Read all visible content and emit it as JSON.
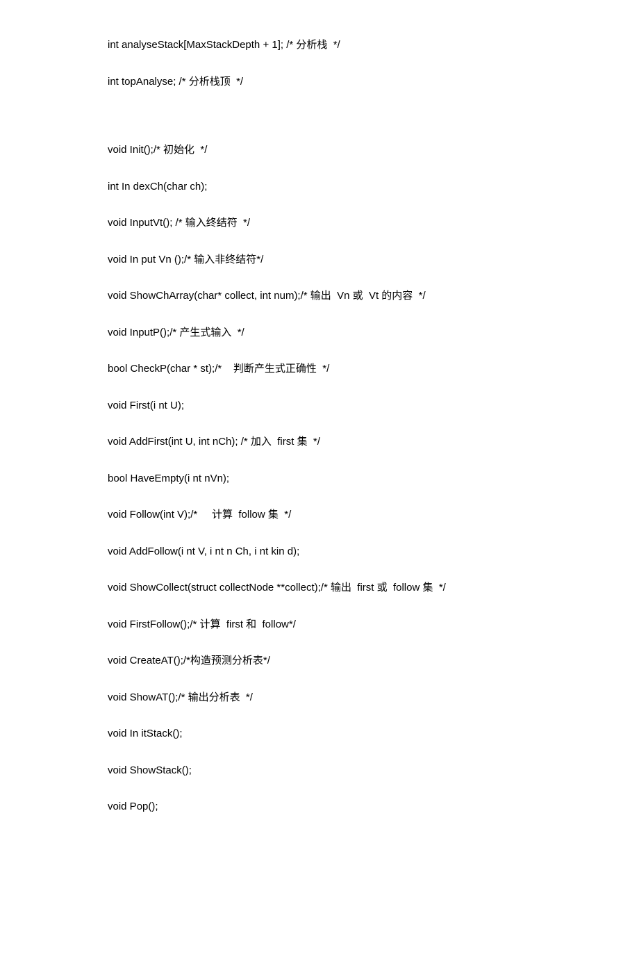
{
  "lines": [
    "int analyseStack[MaxStackDepth + 1]; /* 分析栈  */",
    "int topAnalyse; /* 分析栈顶  */",
    "GAP",
    "void Init();/* 初始化  */",
    "int In dexCh(char ch);",
    "void InputVt(); /* 输入终结符  */",
    "void In put Vn ();/* 输入非终结符*/",
    "void ShowChArray(char* collect, int num);/* 输出  Vn 或  Vt 的内容  */",
    "void InputP();/* 产生式输入  */",
    "bool CheckP(char * st);/*    判断产生式正确性  */",
    "void First(i nt U);",
    "void AddFirst(int U, int nCh); /* 加入  first 集  */",
    "bool HaveEmpty(i nt nVn);",
    "void Follow(int V);/*     计算  follow 集  */",
    "void AddFollow(i nt V, i nt n Ch, i nt kin d);",
    "void ShowCollect(struct collectNode **collect);/* 输出  first 或  follow 集  */",
    "void FirstFollow();/* 计算  first 和  follow*/",
    "void CreateAT();/*构造预测分析表*/",
    "void ShowAT();/* 输出分析表  */",
    "void In itStack();",
    "void ShowStack();",
    "void Pop();"
  ]
}
